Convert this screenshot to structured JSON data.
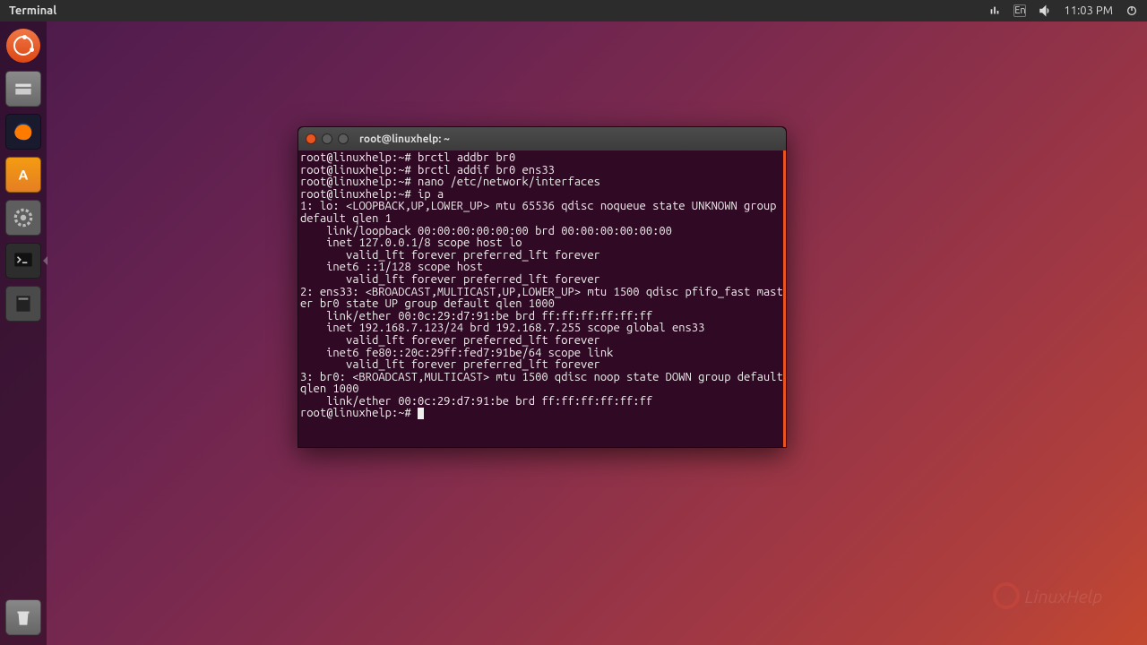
{
  "topbar": {
    "app_name": "Terminal",
    "clock": "11:03 PM",
    "lang_indicator": "En"
  },
  "launcher": {
    "items": [
      "dash",
      "files",
      "firefox",
      "software",
      "settings",
      "terminal",
      "storage"
    ],
    "active": "terminal"
  },
  "terminal": {
    "title": "root@linuxhelp: ~",
    "prompt": "root@linuxhelp:~#",
    "lines": [
      "root@linuxhelp:~# brctl addbr br0",
      "root@linuxhelp:~# brctl addif br0 ens33",
      "root@linuxhelp:~# nano /etc/network/interfaces",
      "root@linuxhelp:~# ip a",
      "1: lo: <LOOPBACK,UP,LOWER_UP> mtu 65536 qdisc noqueue state UNKNOWN group default qlen 1",
      "    link/loopback 00:00:00:00:00:00 brd 00:00:00:00:00:00",
      "    inet 127.0.0.1/8 scope host lo",
      "       valid_lft forever preferred_lft forever",
      "    inet6 ::1/128 scope host",
      "       valid_lft forever preferred_lft forever",
      "2: ens33: <BROADCAST,MULTICAST,UP,LOWER_UP> mtu 1500 qdisc pfifo_fast master br0 state UP group default qlen 1000",
      "    link/ether 00:0c:29:d7:91:be brd ff:ff:ff:ff:ff:ff",
      "    inet 192.168.7.123/24 brd 192.168.7.255 scope global ens33",
      "       valid_lft forever preferred_lft forever",
      "    inet6 fe80::20c:29ff:fed7:91be/64 scope link",
      "       valid_lft forever preferred_lft forever",
      "3: br0: <BROADCAST,MULTICAST> mtu 1500 qdisc noop state DOWN group default qlen 1000",
      "    link/ether 00:0c:29:d7:91:be brd ff:ff:ff:ff:ff:ff"
    ],
    "final_prompt": "root@linuxhelp:~# "
  },
  "watermark": "LinuxHelp"
}
